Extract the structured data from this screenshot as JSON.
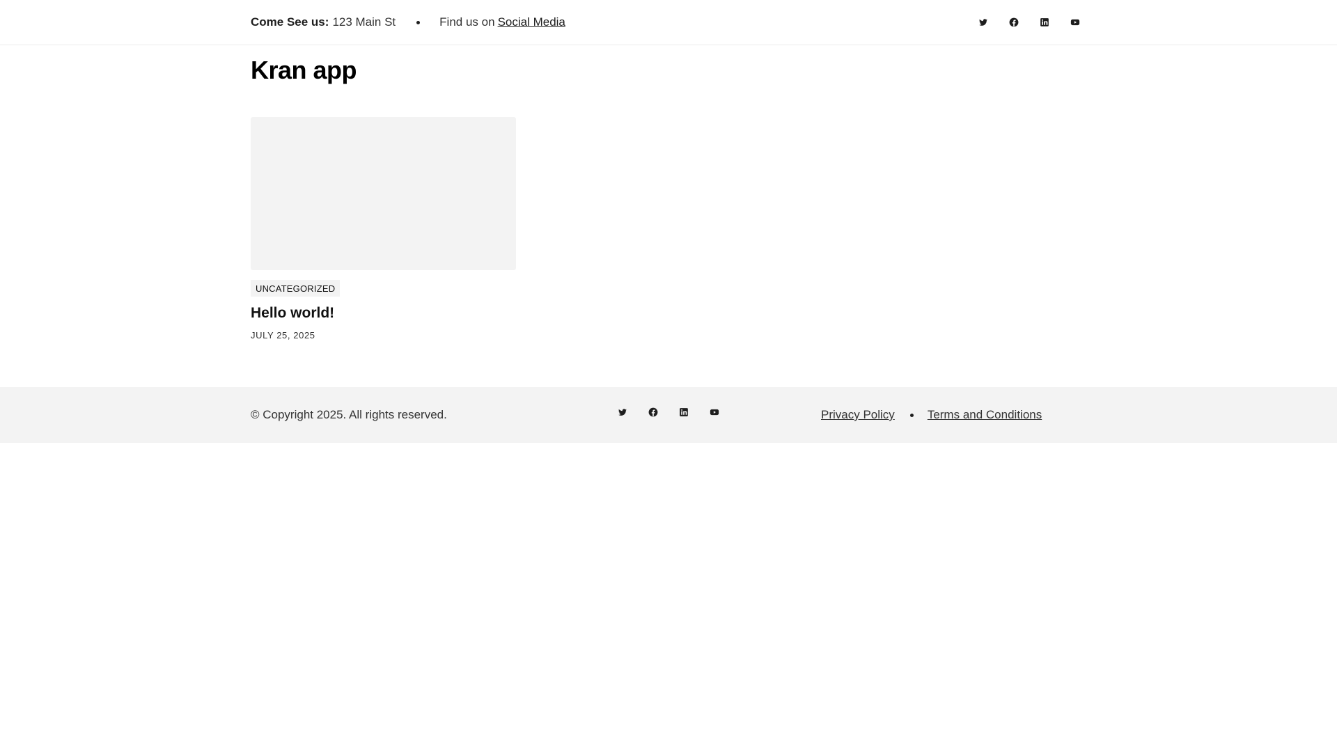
{
  "topbar": {
    "address_label": "Come See us:",
    "address_value": "123 Main St",
    "social_prefix": "Find us on",
    "social_link": "Social Media",
    "icons": [
      "twitter-icon",
      "facebook-icon",
      "linkedin-icon",
      "youtube-icon"
    ]
  },
  "site": {
    "title": "Kran app"
  },
  "posts": [
    {
      "category": "UNCATEGORIZED",
      "title": "Hello world!",
      "date": "JULY 25, 2025"
    }
  ],
  "footer": {
    "copyright": "© Copyright 2025. All rights reserved.",
    "links": [
      "Privacy Policy",
      "Terms and Conditions"
    ],
    "icons": [
      "twitter-icon",
      "facebook-icon",
      "linkedin-icon",
      "youtube-icon"
    ]
  },
  "colors": {
    "text": "#1e1e1e",
    "muted_bg": "#f3f3f3",
    "border": "#ececec"
  }
}
